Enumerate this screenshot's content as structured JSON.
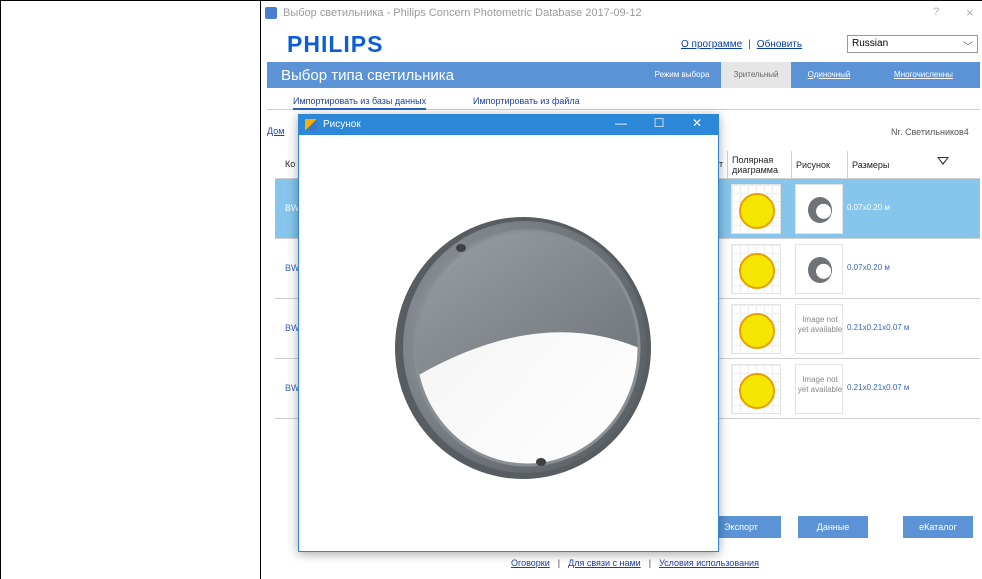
{
  "window": {
    "title": "Выбор светильника - Philips Concern Photometric Database 2017-09-12",
    "help": "?",
    "close": "×"
  },
  "brand": {
    "logo_text": "PHILIPS"
  },
  "top_links": {
    "about": "О программе",
    "separator": "|",
    "update": "Обновить"
  },
  "language": {
    "selected": "Russian"
  },
  "header": {
    "heading": "Выбор типа светильника",
    "modes": [
      "Режим выбора",
      "Зрительный",
      "Одиночный",
      "Многочисленны"
    ]
  },
  "subtabs": [
    "Импортировать из базы данных",
    "Импортировать из файла"
  ],
  "breadcrumb": "Дом",
  "count_label": "Nr. Светильников4",
  "table": {
    "headers": {
      "code": "Ко",
      "partial": "т",
      "polar": "Полярная диаграмма",
      "picture": "Рисунок",
      "dims": "Размеры"
    },
    "rows": [
      {
        "code": "BW",
        "dims": "0.07x0.20 м",
        "image": "available"
      },
      {
        "code": "BW",
        "dims": "0.07x0.20 м",
        "image": "available"
      },
      {
        "code": "BW",
        "dims": "0.21x0.21x0.07 м",
        "image": "Image not yet available"
      },
      {
        "code": "BW",
        "dims": "0.21x0.21x0.07 м",
        "image": "Image not yet available"
      }
    ]
  },
  "buttons": {
    "export": "Экспорт",
    "data": "Данные",
    "ecatalog": "еКаталог"
  },
  "footer": {
    "disclaimer": "Оговорки",
    "contact": "Для связи с нами",
    "terms": "Условия использования",
    "sep": "|"
  },
  "dialog": {
    "title": "Рисунок",
    "minimize": "—",
    "maximize": "☐",
    "close": "✕"
  },
  "colors": {
    "accent": "#5b93d6",
    "selected_row": "#86c5ec",
    "dialog_titlebar": "#2b87d8",
    "brand": "#0b5ed7"
  }
}
